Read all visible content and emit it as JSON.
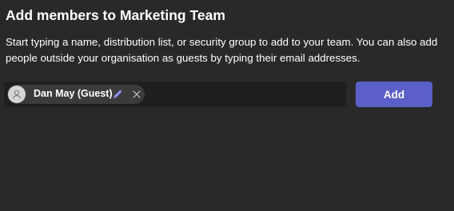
{
  "dialog": {
    "title": "Add members to Marketing Team",
    "description": "Start typing a name, distribution list, or security group to add to your team. You can also add people outside your organisation as guests by typing their email addresses."
  },
  "people_picker": {
    "selected": [
      {
        "name": "Dan May (Guest)",
        "avatar_icon": "person-icon",
        "edit_icon": "pencil-icon",
        "remove_icon": "close-icon"
      }
    ]
  },
  "actions": {
    "add_label": "Add"
  },
  "colors": {
    "background": "#292929",
    "field_background": "#1f1f1f",
    "chip_background": "#3b3b3b",
    "accent": "#5b5fc7",
    "edit_icon": "#8b8ff0"
  }
}
